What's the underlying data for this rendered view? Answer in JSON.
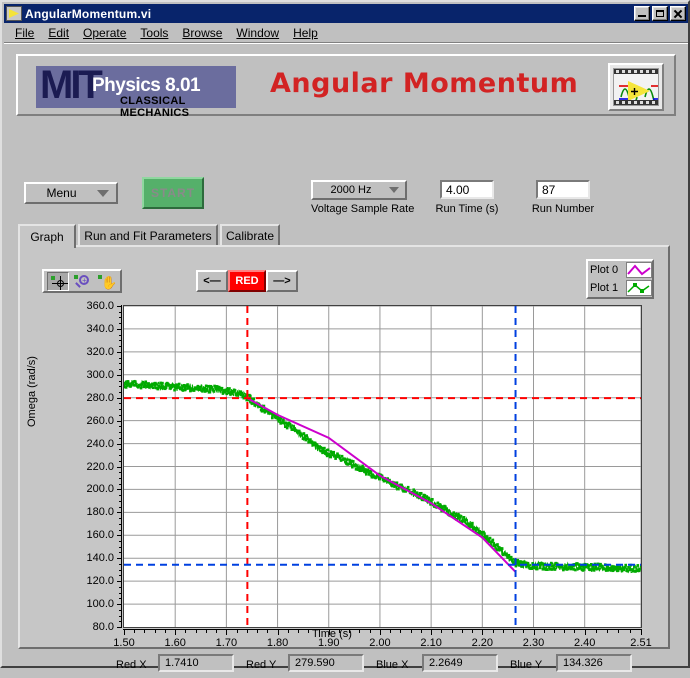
{
  "window": {
    "title": "AngularMomentum.vi",
    "icon": "labview-vi-icon",
    "buttons": {
      "minimize": "minimize-button",
      "maximize": "maximize-button",
      "close": "close-button"
    }
  },
  "menubar": {
    "items": [
      "File",
      "Edit",
      "Operate",
      "Tools",
      "Browse",
      "Window",
      "Help"
    ]
  },
  "banner": {
    "logo": {
      "mit": "MIT",
      "course": "Physics 8.01",
      "subtitle": "CLASSICAL MECHANICS"
    },
    "title": "Angular Momentum",
    "right_icon": "labview-logo-icon"
  },
  "controls": {
    "menu_button": "Menu",
    "start_button": "START",
    "sample_rate": {
      "value": "2000 Hz",
      "caption": "Voltage Sample Rate"
    },
    "run_time": {
      "value": "4.00",
      "caption": "Run Time (s)"
    },
    "run_number": {
      "value": "87",
      "caption": "Run Number"
    }
  },
  "tabs": [
    {
      "label": "Graph",
      "active": true
    },
    {
      "label": "Run and Fit Parameters",
      "active": false
    },
    {
      "label": "Calibrate",
      "active": false
    }
  ],
  "graph_toolbar": {
    "tools": [
      "cursor-tool",
      "zoom-tool",
      "pan-tool"
    ],
    "cursor_prev": "<—",
    "cursor_name": "RED",
    "cursor_next": "—>"
  },
  "legend": {
    "entries": [
      {
        "label": "Plot 0",
        "color": "#cc00cc",
        "style": "line"
      },
      {
        "label": "Plot 1",
        "color": "#00aa00",
        "style": "line-markers"
      }
    ]
  },
  "cursors": {
    "red": {
      "x_label": "Red X",
      "x_value": "1.7410",
      "y_label": "Red Y",
      "y_value": "279.590",
      "color": "#ff0000"
    },
    "blue": {
      "x_label": "Blue X",
      "x_value": "2.2649",
      "y_label": "Blue Y",
      "y_value": "134.326",
      "color": "#0040e0"
    }
  },
  "chart_data": {
    "type": "line",
    "title": "",
    "xlabel": "Time (s)",
    "ylabel": "Omega (rad/s)",
    "xlim": [
      1.5,
      2.51
    ],
    "ylim": [
      80.0,
      360.0
    ],
    "grid": true,
    "legend_position": "top-right",
    "xticks": [
      "1.50",
      "1.60",
      "1.70",
      "1.80",
      "1.90",
      "2.00",
      "2.10",
      "2.20",
      "2.30",
      "2.40",
      "2.51"
    ],
    "xtick_values": [
      1.5,
      1.6,
      1.7,
      1.8,
      1.9,
      2.0,
      2.1,
      2.2,
      2.3,
      2.4,
      2.51
    ],
    "yticks": [
      "80.0",
      "100.0",
      "120.0",
      "140.0",
      "160.0",
      "180.0",
      "200.0",
      "220.0",
      "240.0",
      "260.0",
      "280.0",
      "300.0",
      "320.0",
      "340.0",
      "360.0"
    ],
    "ytick_values": [
      80,
      100,
      120,
      140,
      160,
      180,
      200,
      220,
      240,
      260,
      280,
      300,
      320,
      340,
      360
    ],
    "cursor_lines": [
      {
        "name": "red-cursor",
        "color": "#ff0000",
        "x": 1.741,
        "y": 279.59
      },
      {
        "name": "blue-cursor",
        "color": "#0040e0",
        "x": 2.2649,
        "y": 134.326
      }
    ],
    "series": [
      {
        "name": "Plot 1",
        "color": "#00aa00",
        "description": "measured angular velocity data (noisy)",
        "x": [
          1.5,
          1.52,
          1.54,
          1.56,
          1.58,
          1.6,
          1.62,
          1.64,
          1.66,
          1.68,
          1.7,
          1.72,
          1.741,
          1.76,
          1.78,
          1.8,
          1.82,
          1.84,
          1.86,
          1.88,
          1.9,
          1.92,
          1.94,
          1.96,
          1.98,
          2.0,
          2.02,
          2.04,
          2.06,
          2.08,
          2.1,
          2.12,
          2.14,
          2.16,
          2.18,
          2.2,
          2.22,
          2.24,
          2.265,
          2.285,
          2.305,
          2.325,
          2.345,
          2.365,
          2.385,
          2.405,
          2.425,
          2.445,
          2.465,
          2.485,
          2.51
        ],
        "y": [
          292.0,
          291.5,
          291.0,
          290.5,
          290.0,
          289.5,
          289.0,
          288.5,
          288.0,
          287.0,
          286.0,
          283.5,
          280.5,
          274.0,
          267.5,
          262.0,
          256.0,
          250.0,
          243.0,
          236.0,
          231.5,
          228.0,
          223.5,
          219.0,
          214.0,
          210.0,
          206.0,
          202.0,
          198.0,
          194.0,
          189.0,
          184.0,
          179.0,
          174.0,
          168.0,
          161.0,
          153.0,
          145.0,
          136.0,
          134.0,
          133.5,
          133.0,
          133.0,
          132.5,
          132.5,
          132.0,
          132.0,
          131.5,
          131.5,
          131.0,
          131.0
        ]
      },
      {
        "name": "Plot 0",
        "color": "#cc00cc",
        "description": "linear fit between red and blue cursors",
        "x": [
          1.741,
          1.8,
          1.9,
          2.0,
          2.1,
          2.2,
          2.265
        ],
        "y": [
          279.59,
          265.0,
          245.0,
          212.0,
          188.0,
          158.0,
          128.0
        ]
      }
    ]
  }
}
